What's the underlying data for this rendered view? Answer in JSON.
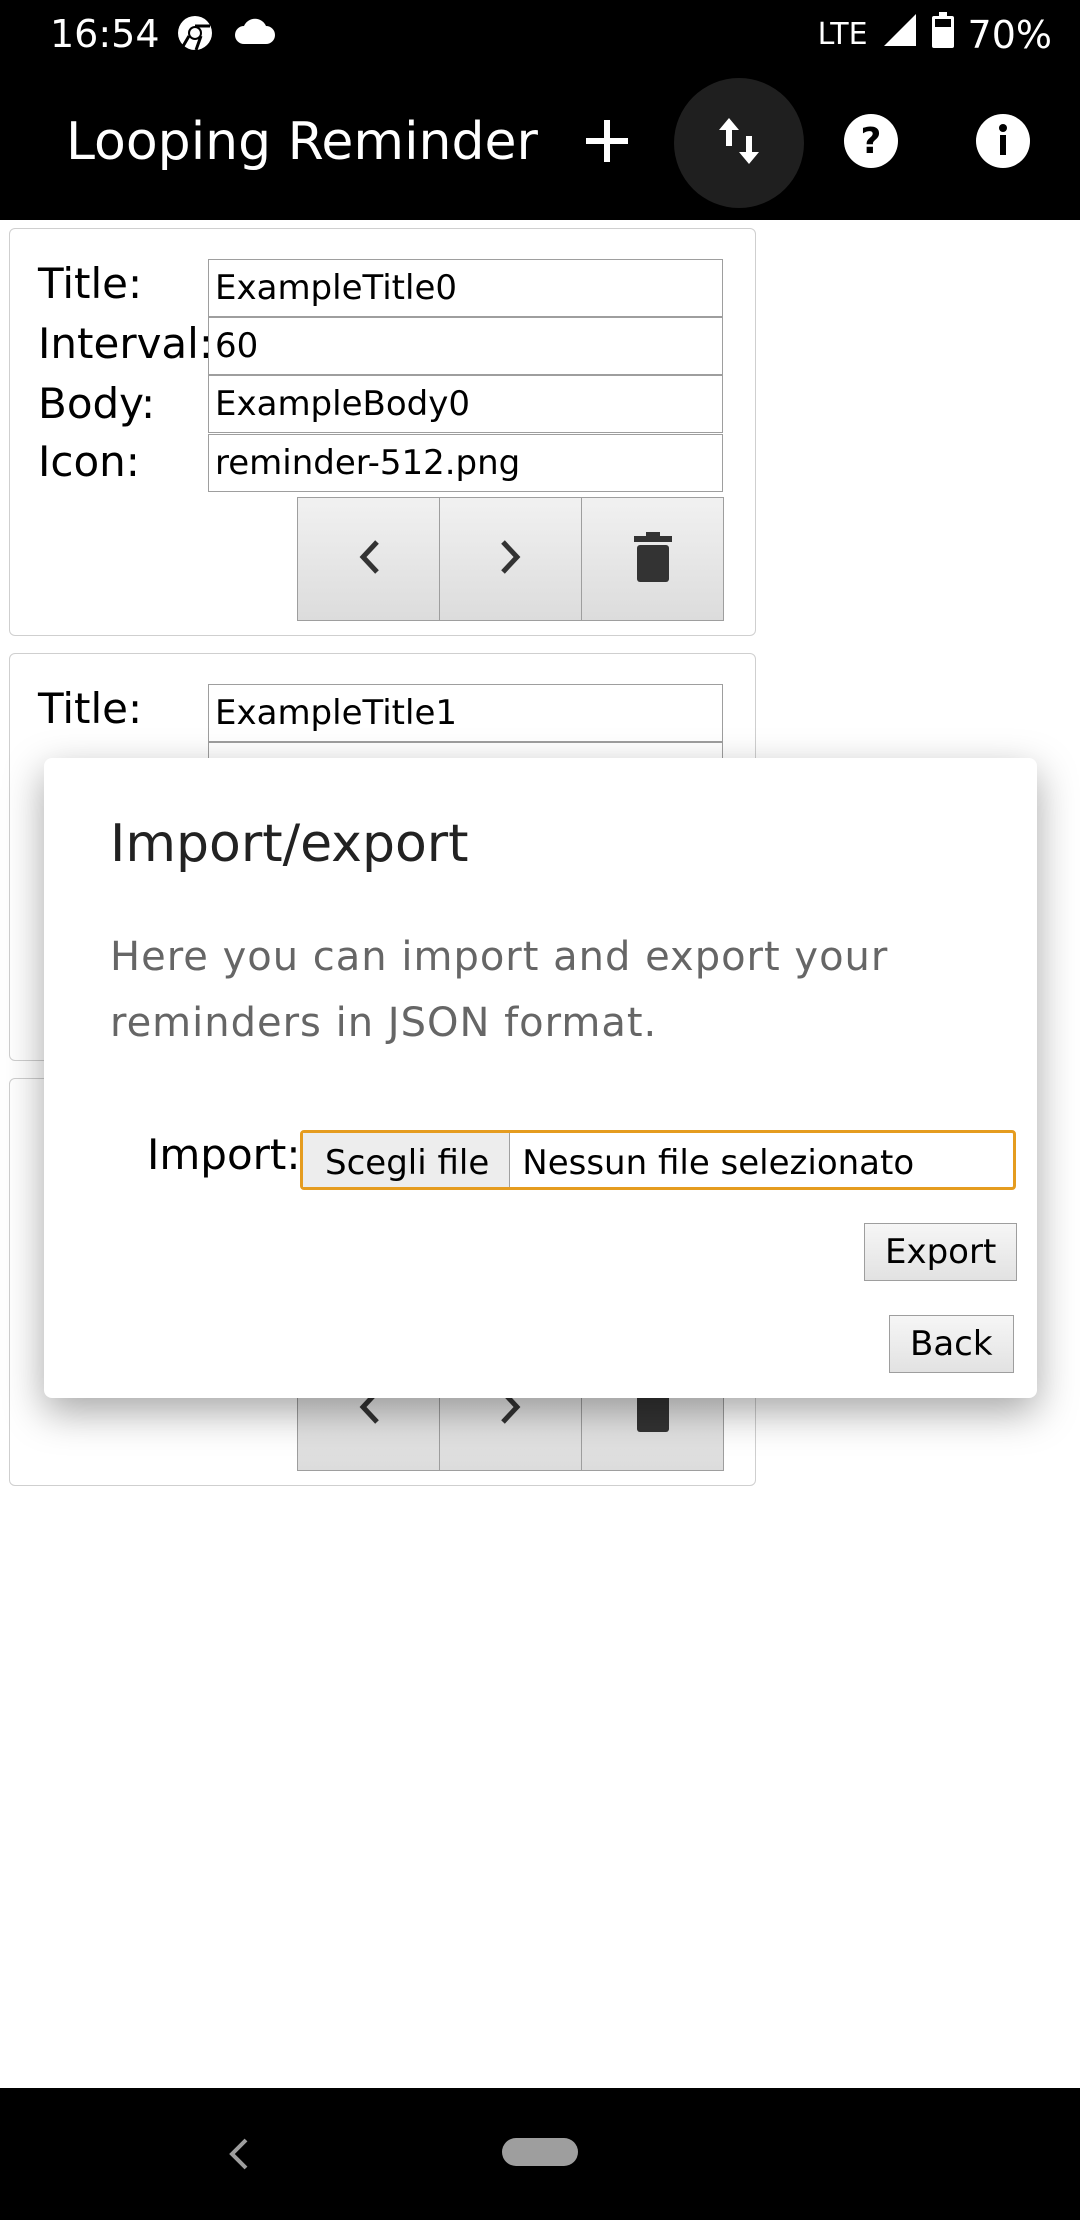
{
  "status_bar": {
    "time": "16:54",
    "network": "LTE",
    "battery": "70%",
    "icons": [
      "chrome-icon",
      "cloud-icon",
      "signal-icon",
      "battery-icon"
    ]
  },
  "app_bar": {
    "title": "Looping Reminder",
    "actions": [
      "add-icon",
      "import-export-icon",
      "help-icon",
      "info-icon"
    ]
  },
  "cards": [
    {
      "labels": {
        "title": "Title:",
        "interval": "Interval:",
        "body": "Body:",
        "icon": "Icon:"
      },
      "values": {
        "title": "ExampleTitle0",
        "interval": "60",
        "body": "ExampleBody0",
        "icon": "reminder-512.png"
      }
    },
    {
      "labels": {
        "title": "Title:"
      },
      "values": {
        "title": "ExampleTitle1"
      }
    }
  ],
  "dialog": {
    "title": "Import/export",
    "text": "Here you can import and export your reminders in JSON format.",
    "import_label": "Import:",
    "file_button": "Scegli file",
    "file_status": "Nessun file selezionato",
    "export_label": "Export",
    "back_label": "Back"
  },
  "colors": {
    "bar_background": "#000000",
    "focus_outline": "#e59c1f"
  }
}
